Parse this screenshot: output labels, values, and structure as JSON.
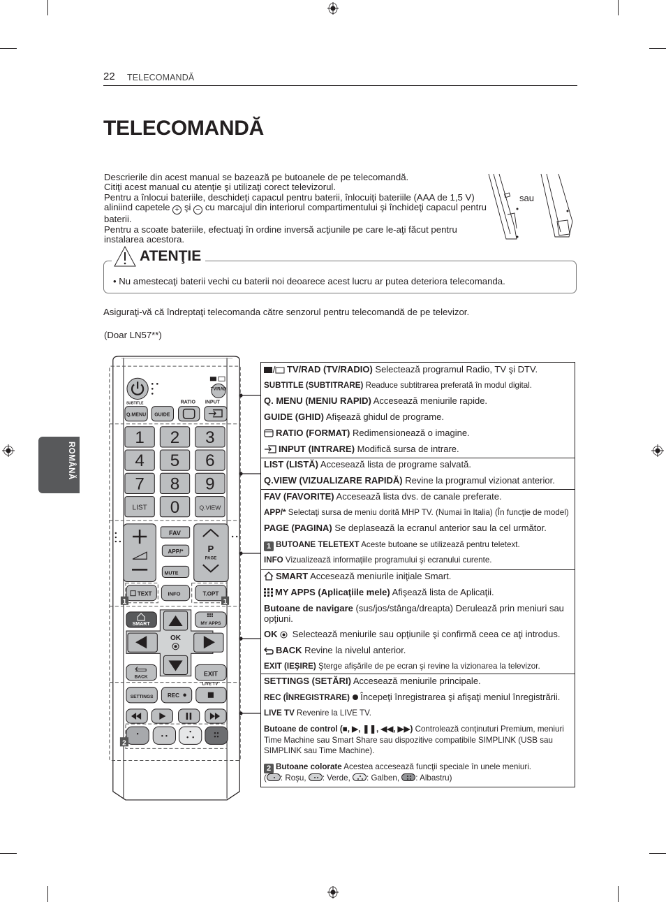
{
  "header": {
    "page_number": "22",
    "section": "TELECOMANDĂ"
  },
  "title": "TELECOMANDĂ",
  "intro": {
    "line1": "Descrierile din acest manual se bazează pe butoanele de pe telecomandă.",
    "line2": "Citiţi acest manual cu atenţie şi utilizaţi corect televizorul.",
    "line3a": "Pentru a înlocui bateriile, deschideţi capacul pentru baterii, înlocuiţi bateriile (AAA de 1,5 V) aliniind capetele",
    "plus_symbol": "+",
    "and_word": "şi",
    "minus_symbol": "−",
    "line3b": "cu marcajul din interiorul compartimentului şi închideţi capacul pentru baterii.",
    "line4": "Pentru a scoate bateriile, efectuaţi în ordine inversă acţiunile pe care le-aţi făcut pentru instalarea acestora.",
    "or_label": "sau"
  },
  "attention": {
    "title": "ATENŢIE",
    "bullet": "•  Nu amestecaţi baterii vechi cu baterii noi deoarece acest lucru ar putea deteriora telecomanda."
  },
  "paragraph": "Asiguraţi-vă că îndreptaţi telecomanda către senzorul pentru telecomandă de pe televizor.",
  "model_note": "(Doar LN57**)",
  "remote": {
    "subtitle": "SUBTITLE",
    "ratio": "RATIO",
    "input": "INPUT",
    "qmenu": "Q.MENU",
    "guide": "GUIDE",
    "tvrad": "TV/RAD",
    "digits": [
      "1",
      "2",
      "3",
      "4",
      "5",
      "6",
      "7",
      "8",
      "9"
    ],
    "list": "LIST",
    "zero": "0",
    "qview": "Q.VIEW",
    "fav": "FAV",
    "app": "APP/*",
    "mute": "MUTE",
    "p": "P",
    "page": "PAGE",
    "text": "TEXT",
    "info": "INFO",
    "topt": "T.OPT",
    "smart": "SMART",
    "myapps": "MY APPS",
    "ok": "OK",
    "back": "BACK",
    "exit": "EXIT",
    "livetv": "LIVE TV",
    "settings": "SETTINGS",
    "rec": "REC",
    "badge1": "1",
    "badge2": "2"
  },
  "table": {
    "sec1": [
      {
        "bold": "TV/RAD (TV/RADIO)",
        "text": " Selectează programul Radio, TV şi DTV."
      },
      {
        "bold": "SUBTITLE (SUBTITRARE)",
        "text": " Readuce subtitrarea preferată în modul digital."
      },
      {
        "bold": "Q. MENU (MENIU RAPID)",
        "text": " Accesează meniurile rapide."
      },
      {
        "bold": "GUIDE (GHID)",
        "text": " Afişează ghidul de programe."
      },
      {
        "bold": "RATIO (FORMAT)",
        "text": " Redimensionează o imagine."
      },
      {
        "bold": "INPUT (INTRARE)",
        "text": " Modifică sursa de intrare."
      }
    ],
    "sec2": [
      {
        "bold": "LIST (LISTĂ)",
        "text": " Accesează lista de programe salvată."
      },
      {
        "bold": "Q.VIEW (VIZUALIZARE RAPIDĂ)",
        "text": " Revine la programul vizionat anterior."
      }
    ],
    "sec3": [
      {
        "bold": "FAV (FAVORITE)",
        "text": " Accesează lista dvs. de canale preferate."
      },
      {
        "bold": "APP/*",
        "text": " Selectaţi sursa de meniu dorită MHP TV. (Numai în Italia) (În funcţie de model)"
      },
      {
        "bold": "PAGE (PAGINA)",
        "text": " Se deplasează la ecranul anterior sau la cel următor."
      },
      {
        "badge": "1",
        "bold": "BUTOANE TELETEXT",
        "text": " Aceste butoane se utilizează pentru teletext."
      },
      {
        "bold": "INFO",
        "text": " Vizualizează informaţiile programului şi ecranului curente."
      }
    ],
    "sec4": [
      {
        "bold": "SMART",
        "text": " Accesează meniurile iniţiale Smart."
      },
      {
        "bold": "MY APPS (Aplicaţiile mele)",
        "text": " Afişează lista de Aplicaţii."
      },
      {
        "bold": "Butoane de navigare",
        "text": " (sus/jos/stânga/dreapta) Derulează prin meniuri sau opţiuni."
      },
      {
        "bold": "OK",
        "text": " Selectează meniurile sau opţiunile şi confirmă ceea ce aţi introdus."
      },
      {
        "bold": "BACK",
        "text": " Revine la nivelul anterior."
      },
      {
        "bold": "EXIT (IEŞIRE)",
        "text": "  Şterge afişările de pe ecran şi revine la vizionarea la televizor."
      }
    ],
    "sec5": [
      {
        "bold": "SETTINGS (SETĂRI)",
        "text": " Accesează meniurile principale."
      },
      {
        "bold": "REC (ÎNREGISTRARE)",
        "text": " Începeţi înregistrarea şi afişaţi meniul înregistrării."
      },
      {
        "bold": "LIVE TV",
        "text": " Revenire la LIVE TV."
      },
      {
        "bold": "Butoane de control",
        "symbols": " (■, ▶, ❚❚, ◀◀, ▶▶)",
        "text": " Controlează conţinuturi Premium, meniuri Time Machine sau Smart Share sau dispozitive compatibile SIMPLINK (USB sau SIMPLINK sau Time Machine)."
      },
      {
        "badge": "2",
        "bold": "Butoane colorate",
        "text": " Acestea accesează funcţii speciale în unele meniuri."
      },
      {
        "colors": [
          ": Roşu, ",
          ": Verde, ",
          ": Galben, ",
          ": Albastru)"
        ],
        "open": "("
      }
    ]
  },
  "side_tab": "ROMÂNĂ",
  "colors": {
    "button_gray": "#bcbec0",
    "dark_button": "#58595b",
    "blue_button": "#6d6e71",
    "yellow_button": "#e6e7e8",
    "green_button": "#c7c8ca",
    "red_button": "#a7a9ac",
    "tab_bg": "#58595b"
  }
}
